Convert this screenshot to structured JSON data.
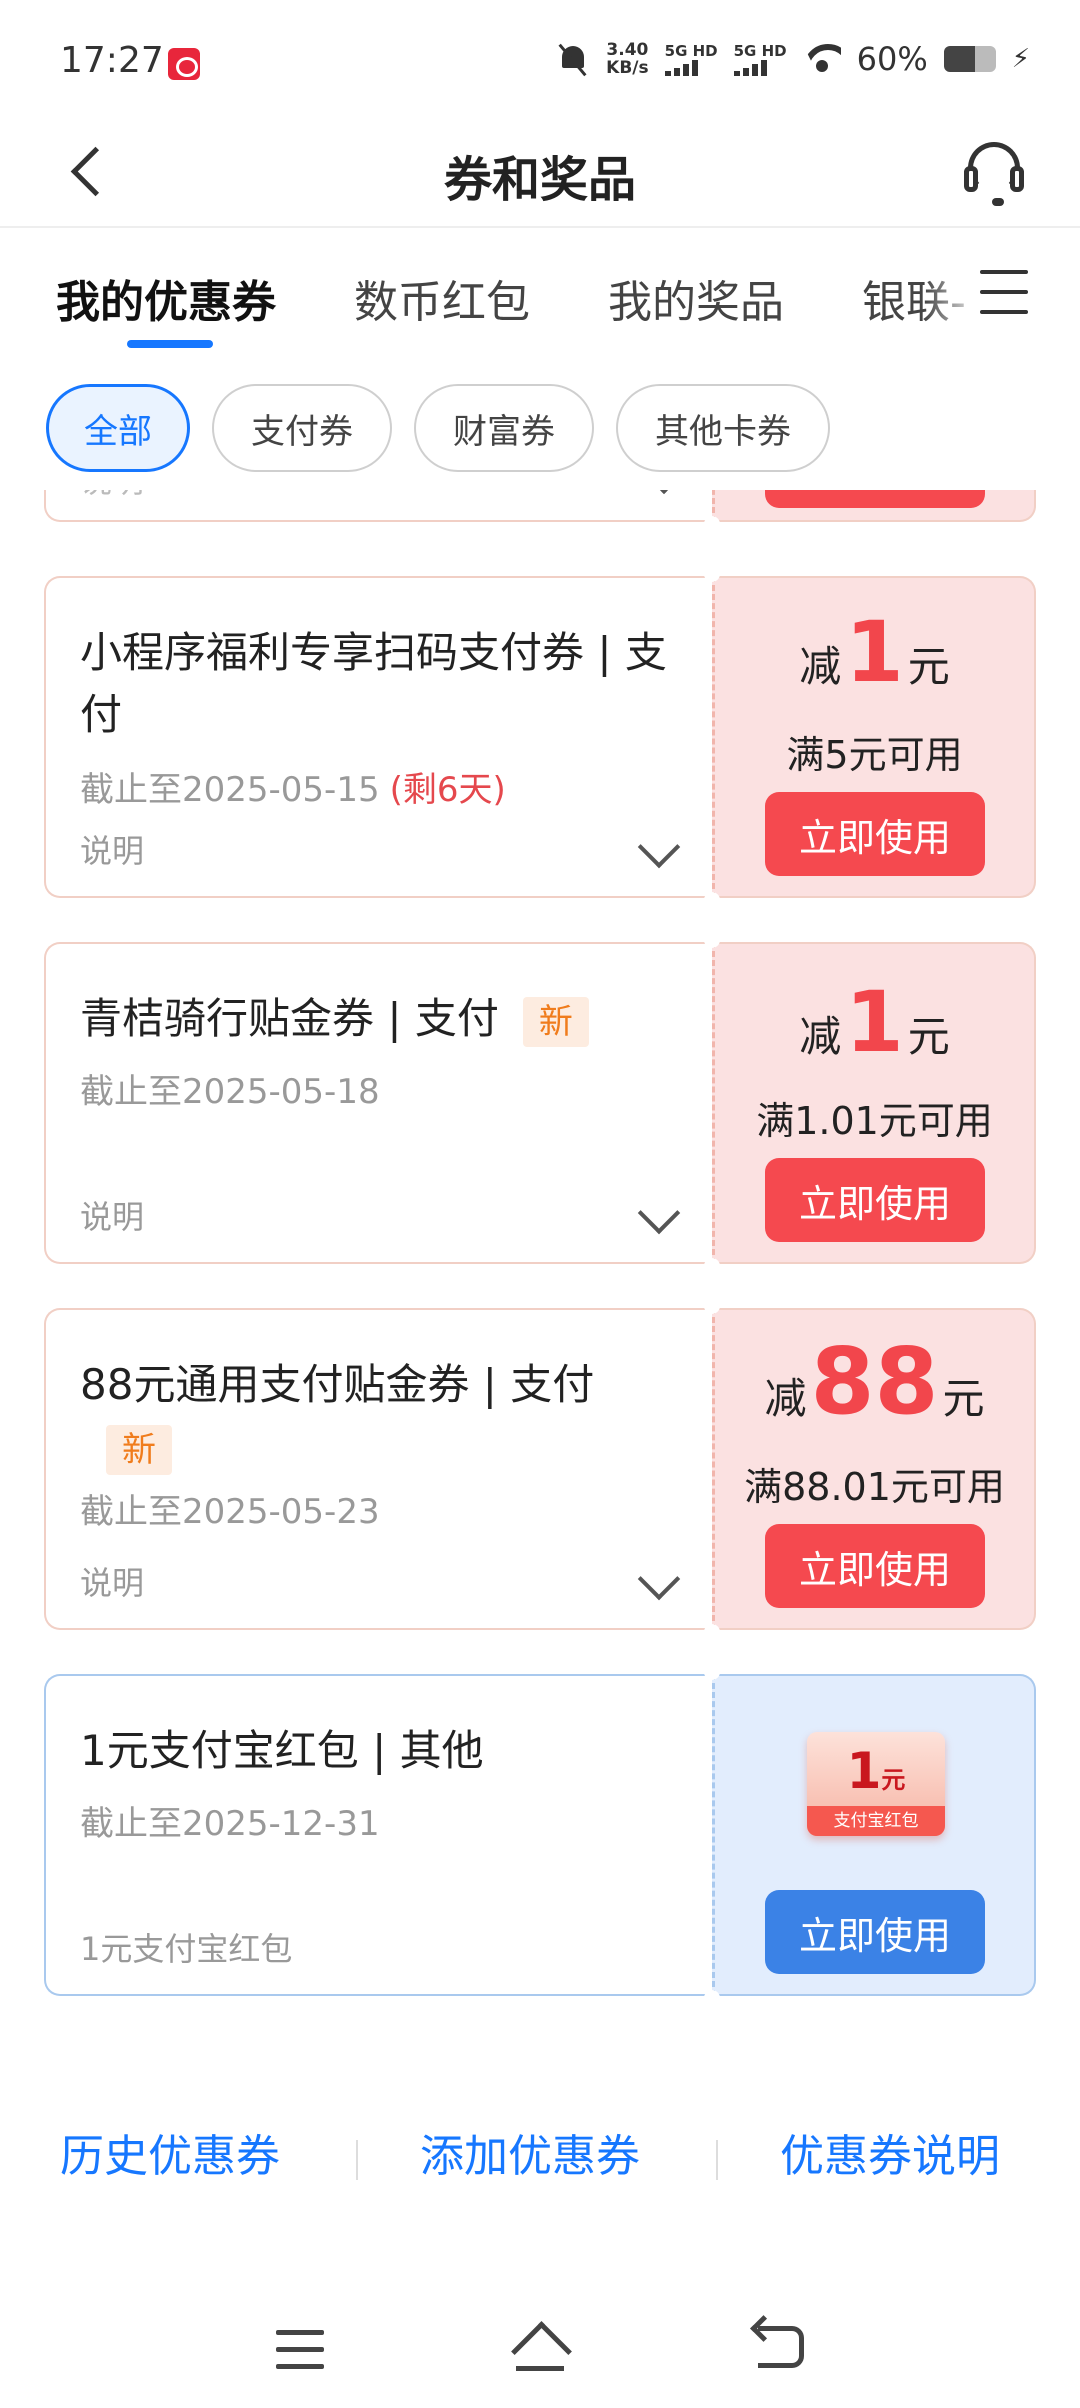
{
  "status_bar": {
    "time": "17:27",
    "net_speed": "3.40",
    "net_unit": "KB/s",
    "sim1": "5G HD",
    "sim2": "5G HD",
    "battery": "60%"
  },
  "header": {
    "title": "券和奖品"
  },
  "tabs": [
    {
      "label": "我的优惠券",
      "active": true
    },
    {
      "label": "数币红包"
    },
    {
      "label": "我的奖品"
    },
    {
      "label": "银联-"
    }
  ],
  "filters": [
    {
      "label": "全部",
      "active": true
    },
    {
      "label": "支付券"
    },
    {
      "label": "财富券"
    },
    {
      "label": "其他卡券"
    }
  ],
  "partial_card": {
    "note": "说明"
  },
  "coupons": [
    {
      "title": "小程序福利专享扫码支付券 | 支付",
      "date": "截止至2025-05-15",
      "remaining": "(剩6天)",
      "note": "说明",
      "amount_prefix": "减",
      "amount": "1",
      "amount_unit": "元",
      "condition": "满5元可用",
      "button": "立即使用"
    },
    {
      "title": "青桔骑行贴金券 | 支付",
      "tag": "新",
      "date": "截止至2025-05-18",
      "note": "说明",
      "amount_prefix": "减",
      "amount": "1",
      "amount_unit": "元",
      "condition": "满1.01元可用",
      "button": "立即使用"
    },
    {
      "title": "88元通用支付贴金券 | 支付",
      "tag": "新",
      "date": "截止至2025-05-23",
      "note": "说明",
      "amount_prefix": "减",
      "amount": "88",
      "amount_unit": "元",
      "condition": "满88.01元可用",
      "button": "立即使用"
    },
    {
      "title": "1元支付宝红包 | 其他",
      "date": "截止至2025-12-31",
      "note": "1元支付宝红包",
      "hongbao_amount": "1",
      "hongbao_unit": "元",
      "hongbao_label": "支付宝红包",
      "button": "立即使用"
    }
  ],
  "footer_links": [
    {
      "label": "历史优惠券"
    },
    {
      "label": "添加优惠券"
    },
    {
      "label": "优惠券说明"
    }
  ],
  "colors": {
    "accent_blue": "#1677ff",
    "coupon_red": "#f5494f",
    "tag_orange": "#f07c1c"
  }
}
